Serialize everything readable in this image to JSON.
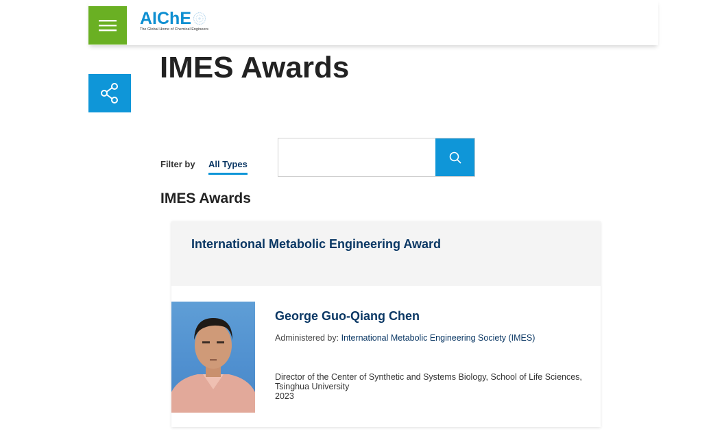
{
  "header": {
    "logo_text": "AIChE",
    "logo_tagline": "The Global Home of Chemical Engineers",
    "menu_icon": "hamburger-icon",
    "share_icon": "share-icon"
  },
  "page": {
    "title": "IMES Awards"
  },
  "filter": {
    "label": "Filter by",
    "selected": "All Types",
    "search_placeholder": "",
    "search_icon": "search-icon"
  },
  "section": {
    "title": "IMES Awards"
  },
  "award": {
    "title": "International Metabolic Engineering Award",
    "recipient": {
      "name": "George Guo-Qiang Chen",
      "administered_label": "Administered by:",
      "administered_by": "International Metabolic Engineering Society (IMES)",
      "position": "Director of the Center of Synthetic and Systems Biology, School of Life Sciences, Tsinghua University",
      "year": "2023"
    }
  },
  "colors": {
    "brand_green": "#6ab023",
    "brand_blue": "#0f96d8",
    "navy": "#0a3764"
  }
}
